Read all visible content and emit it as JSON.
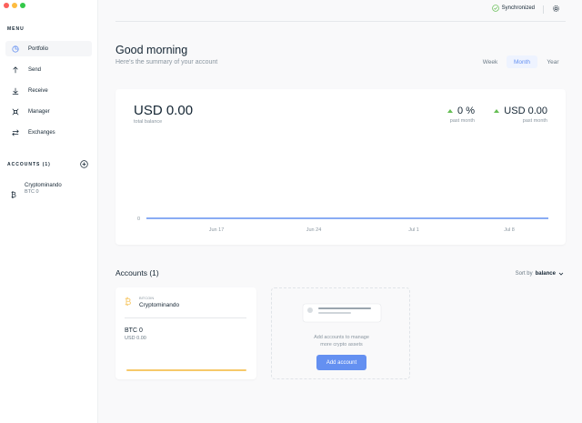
{
  "window": {
    "traffic_colors": [
      "#fc605b",
      "#fdbc40",
      "#34c84a"
    ]
  },
  "sidebar": {
    "menu_title": "MENU",
    "items": [
      {
        "label": "Portfolio",
        "icon": "pie-chart-icon",
        "active": true
      },
      {
        "label": "Send",
        "icon": "arrow-up-icon",
        "active": false
      },
      {
        "label": "Receive",
        "icon": "arrow-down-icon",
        "active": false
      },
      {
        "label": "Manager",
        "icon": "manager-icon",
        "active": false
      },
      {
        "label": "Exchanges",
        "icon": "exchange-icon",
        "active": false
      }
    ],
    "accounts_title": "ACCOUNTS (1)",
    "add_account_icon": "plus-circle-icon",
    "accounts": [
      {
        "name": "Cryptominando",
        "balance": "BTC 0",
        "icon": "bitcoin-icon"
      }
    ]
  },
  "topbar": {
    "sync_label": "Synchronized",
    "sync_icon": "check-circle-icon",
    "settings_icon": "gear-icon"
  },
  "greeting": {
    "title": "Good morning",
    "subtitle": "Here's the summary of your account"
  },
  "periods": [
    {
      "label": "Week",
      "active": false
    },
    {
      "label": "Month",
      "active": true
    },
    {
      "label": "Year",
      "active": false
    }
  ],
  "balance": {
    "total": "USD 0.00",
    "total_label": "total balance",
    "change_pct": "0 %",
    "change_pct_label": "past month",
    "change_fiat": "USD 0.00",
    "change_fiat_label": "past month"
  },
  "chart_data": {
    "type": "line",
    "x": [
      "Jun 17",
      "Jun 24",
      "Jul 1",
      "Jul 8"
    ],
    "series": [
      {
        "values": [
          0,
          0,
          0,
          0
        ]
      }
    ],
    "ytick_labels": [
      "0"
    ],
    "line_color": "#6490f1"
  },
  "accounts_section": {
    "title": "Accounts (1)",
    "sort_label": "Sort by",
    "sort_value": "balance"
  },
  "account_card": {
    "currency": "BITCOIN",
    "name": "Cryptominando",
    "balance": "BTC 0",
    "fiat": "USD 0.00",
    "icon": "bitcoin-icon",
    "color": "#f7c96a"
  },
  "empty_card": {
    "text_line1": "Add accounts to manage",
    "text_line2": "more crypto assets",
    "button": "Add account"
  },
  "colors": {
    "accent": "#6490f1",
    "positive": "#66be54"
  }
}
